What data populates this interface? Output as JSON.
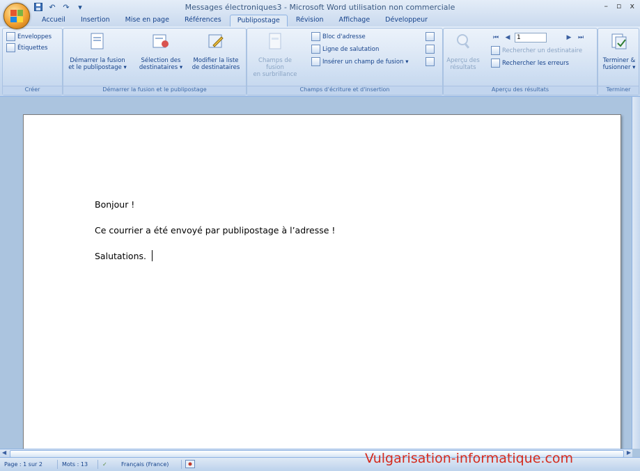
{
  "window": {
    "title": "Messages électroniques3 - Microsoft Word utilisation non commerciale",
    "minimize": "–",
    "maximize": "▫",
    "close": "x"
  },
  "qat": {
    "save_icon": "save-icon",
    "undo": "↶",
    "redo": "↷",
    "more": "▾"
  },
  "tabs": [
    {
      "label": "Accueil"
    },
    {
      "label": "Insertion"
    },
    {
      "label": "Mise en page"
    },
    {
      "label": "Références"
    },
    {
      "label": "Publipostage",
      "active": true
    },
    {
      "label": "Révision"
    },
    {
      "label": "Affichage"
    },
    {
      "label": "Développeur"
    }
  ],
  "ribbon": {
    "creer": {
      "label": "Créer",
      "enveloppes": "Enveloppes",
      "etiquettes": "Étiquettes"
    },
    "demarrer": {
      "label": "Démarrer la fusion et le publipostage",
      "demarrer_fusion_1": "Démarrer la fusion",
      "demarrer_fusion_2": "et le publipostage ▾",
      "selection_1": "Sélection des",
      "selection_2": "destinataires ▾",
      "modifier_1": "Modifier la liste",
      "modifier_2": "de destinataires"
    },
    "champs": {
      "label": "Champs d'écriture et d'insertion",
      "surbrillance_1": "Champs de fusion",
      "surbrillance_2": "en surbrillance",
      "bloc_adresse": "Bloc d'adresse",
      "ligne_salutation": "Ligne de salutation",
      "inserer_champ": "Insérer un champ de fusion ▾"
    },
    "apercu": {
      "label": "Aperçu des résultats",
      "apercu_1": "Aperçu des",
      "apercu_2": "résultats",
      "record_value": "1",
      "rechercher_destinataire": "Rechercher un destinataire",
      "rechercher_erreurs": "Rechercher les erreurs"
    },
    "terminer": {
      "label": "Terminer",
      "terminer_1": "Terminer &",
      "terminer_2": "fusionner ▾"
    }
  },
  "document": {
    "line1": "Bonjour !",
    "line2": "Ce courrier a été envoyé par publipostage à l’adresse !",
    "line3": "Salutations."
  },
  "statusbar": {
    "page": "Page : 1 sur 2",
    "words": "Mots : 13",
    "language": "Français (France)"
  },
  "watermark": "Vulgarisation-informatique.com",
  "colors": {
    "accent": "#15428b",
    "ribbon": "#c8daf0",
    "watermark": "#d42b1e"
  }
}
